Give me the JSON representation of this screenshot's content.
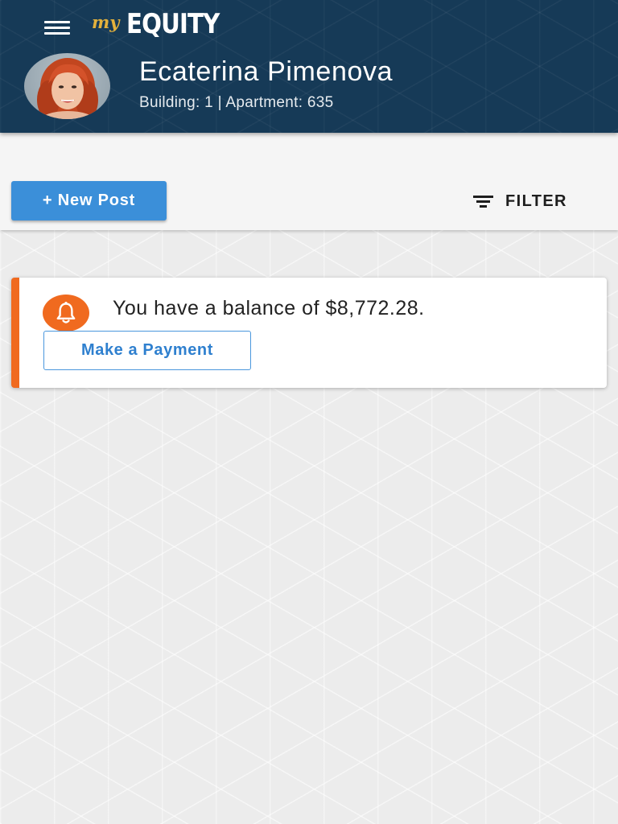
{
  "header": {
    "logo_prefix": "my",
    "logo_brand": "EQUITY",
    "menu_icon": "hamburger-menu-icon",
    "user": {
      "name": "Ecaterina Pimenova",
      "details": "Building: 1 | Apartment: 635"
    }
  },
  "toolbar": {
    "new_post_label": "+ New Post",
    "filter_label": "FILTER",
    "filter_icon": "filter-lines-icon"
  },
  "alerts": [
    {
      "icon": "bell-icon",
      "message": "You have a balance of $8,772.28.",
      "action_label": "Make a Payment"
    }
  ],
  "colors": {
    "header_bg": "#163a57",
    "logo_accent": "#e3b13c",
    "primary_button": "#3b8fd9",
    "alert_accent": "#f06a1f",
    "link_blue": "#2f80cf"
  }
}
